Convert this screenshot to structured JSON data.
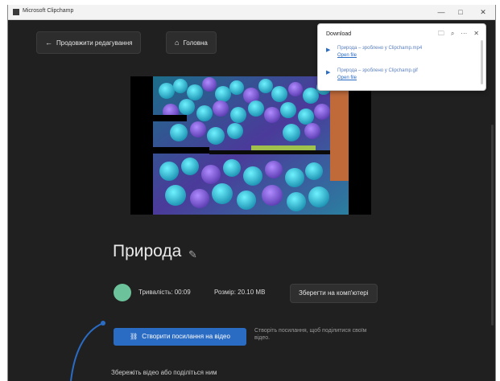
{
  "window": {
    "title": "Microsoft Clipchamp",
    "minimize_glyph": "—",
    "maximize_glyph": "□",
    "close_glyph": "✕"
  },
  "nav": {
    "back_icon": "←",
    "continue_label": "Продовжити редагування",
    "home_icon": "⌂",
    "home_label": "Головна"
  },
  "project": {
    "title": "Природа",
    "edit_icon": "✎",
    "duration_label": "Тривалість: 00:09",
    "size_label": "Розмір: 20.10 МВ",
    "save_pc_label": "Зберегти на комп'ютері"
  },
  "actions": {
    "create_link_icon": "⛓",
    "create_link_label": "Створити посилання на відео",
    "create_link_hint": "Створіть посилання, щоб поділитися своїм відео.",
    "bottom_text": "Збережіть відео або поділіться ним"
  },
  "download": {
    "title": "Download",
    "folder_icon": "🗀",
    "search_icon": "⌕",
    "more_icon": "···",
    "close_icon": "✕",
    "items": [
      {
        "name": "Природа – зроблено у Clipchamp.mp4",
        "link": "Open file"
      },
      {
        "name": "Природа – зроблено у Clipchamp.gif",
        "link": "Open file"
      }
    ]
  },
  "colors": {
    "accent": "#2a6bc4",
    "background": "#202020",
    "avatar": "#6cc29a"
  }
}
